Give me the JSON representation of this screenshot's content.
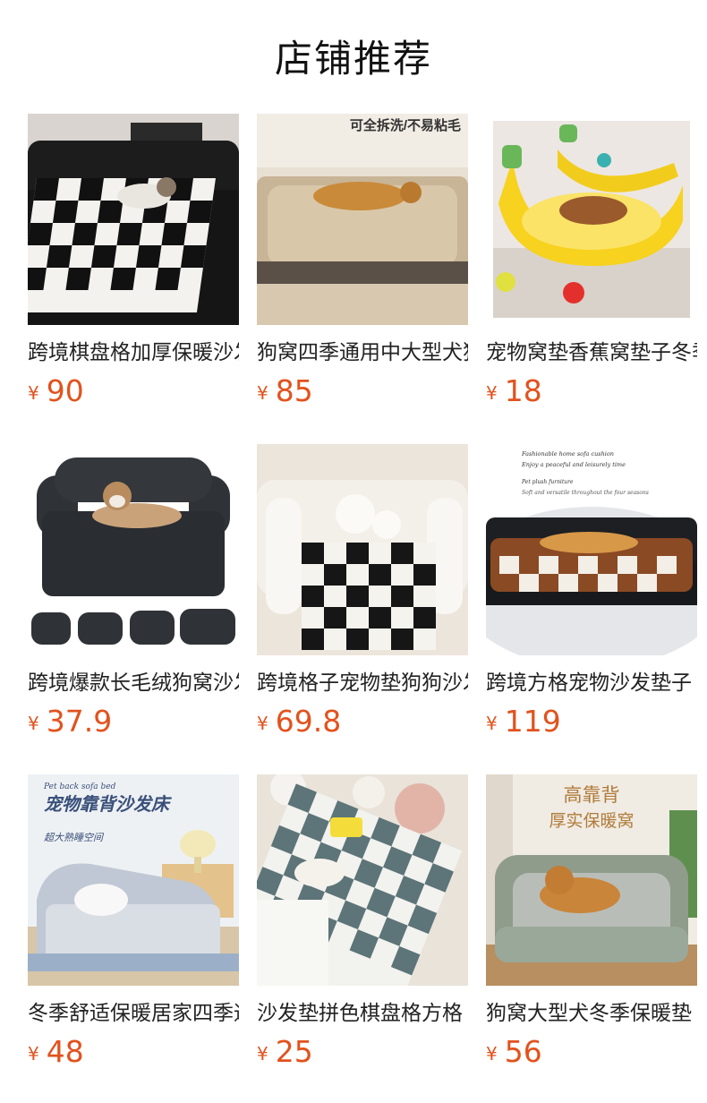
{
  "header": {
    "title": "店铺推荐"
  },
  "products": [
    {
      "title": "跨境棋盘格加厚保暖沙发垫",
      "currency": "¥",
      "price": "90"
    },
    {
      "title": "狗窝四季通用中大型犬狗垫",
      "currency": "¥",
      "price": "85",
      "image_text": "可全拆洗/不易粘毛"
    },
    {
      "title": "宠物窝垫香蕉窝垫子冬季",
      "currency": "¥",
      "price": "18"
    },
    {
      "title": "跨境爆款长毛绒狗窝沙发",
      "currency": "¥",
      "price": "37.9"
    },
    {
      "title": "跨境格子宠物垫狗狗沙发",
      "currency": "¥",
      "price": "69.8"
    },
    {
      "title": "跨境方格宠物沙发垫子",
      "currency": "¥",
      "price": "119",
      "image_text_1": "Fashionable home sofa cushion",
      "image_text_2": "Enjoy a peaceful and leisurely time",
      "image_text_3": "Pet plush furniture",
      "image_text_4": "Soft and versatile throughout the four seasons"
    },
    {
      "title": "冬季舒适保暖居家四季通用",
      "currency": "¥",
      "price": "48",
      "image_text_1": "Pet back sofa bed",
      "image_text_2": "宠物靠背沙发床",
      "image_text_3": "超大熟睡空间"
    },
    {
      "title": "沙发垫拼色棋盘格方格",
      "currency": "¥",
      "price": "25"
    },
    {
      "title": "狗窝大型犬冬季保暖垫",
      "currency": "¥",
      "price": "56",
      "image_text_1": "高靠背",
      "image_text_2": "厚实保暖窝"
    }
  ],
  "colors": {
    "price": "#e2521d",
    "title": "#222222"
  },
  "icons": [
    "product-photo-image"
  ]
}
